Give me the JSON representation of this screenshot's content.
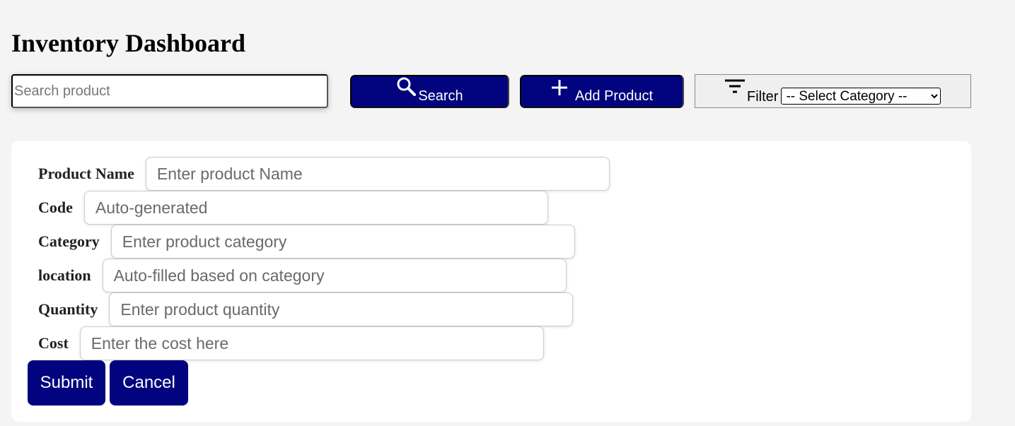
{
  "page": {
    "title": "Inventory Dashboard"
  },
  "toolbar": {
    "search_placeholder": "Search product",
    "search_label": "Search",
    "add_label": "Add Product",
    "filter_label": "Filter",
    "filter_selected": "-- Select Category --"
  },
  "form": {
    "fields": [
      {
        "label": "Product Name",
        "placeholder": "Enter product Name"
      },
      {
        "label": "Code",
        "placeholder": "Auto-generated"
      },
      {
        "label": "Category",
        "placeholder": "Enter product category"
      },
      {
        "label": "location",
        "placeholder": "Auto-filled based on category"
      },
      {
        "label": "Quantity",
        "placeholder": "Enter product quantity"
      },
      {
        "label": "Cost",
        "placeholder": "Enter the cost here"
      }
    ],
    "submit_label": "Submit",
    "cancel_label": "Cancel"
  },
  "icons": {
    "search": "search-icon",
    "add": "plus-icon",
    "filter": "filter-icon"
  },
  "colors": {
    "accent": "#02037e",
    "background": "#f4f4f4",
    "card": "#ffffff"
  }
}
